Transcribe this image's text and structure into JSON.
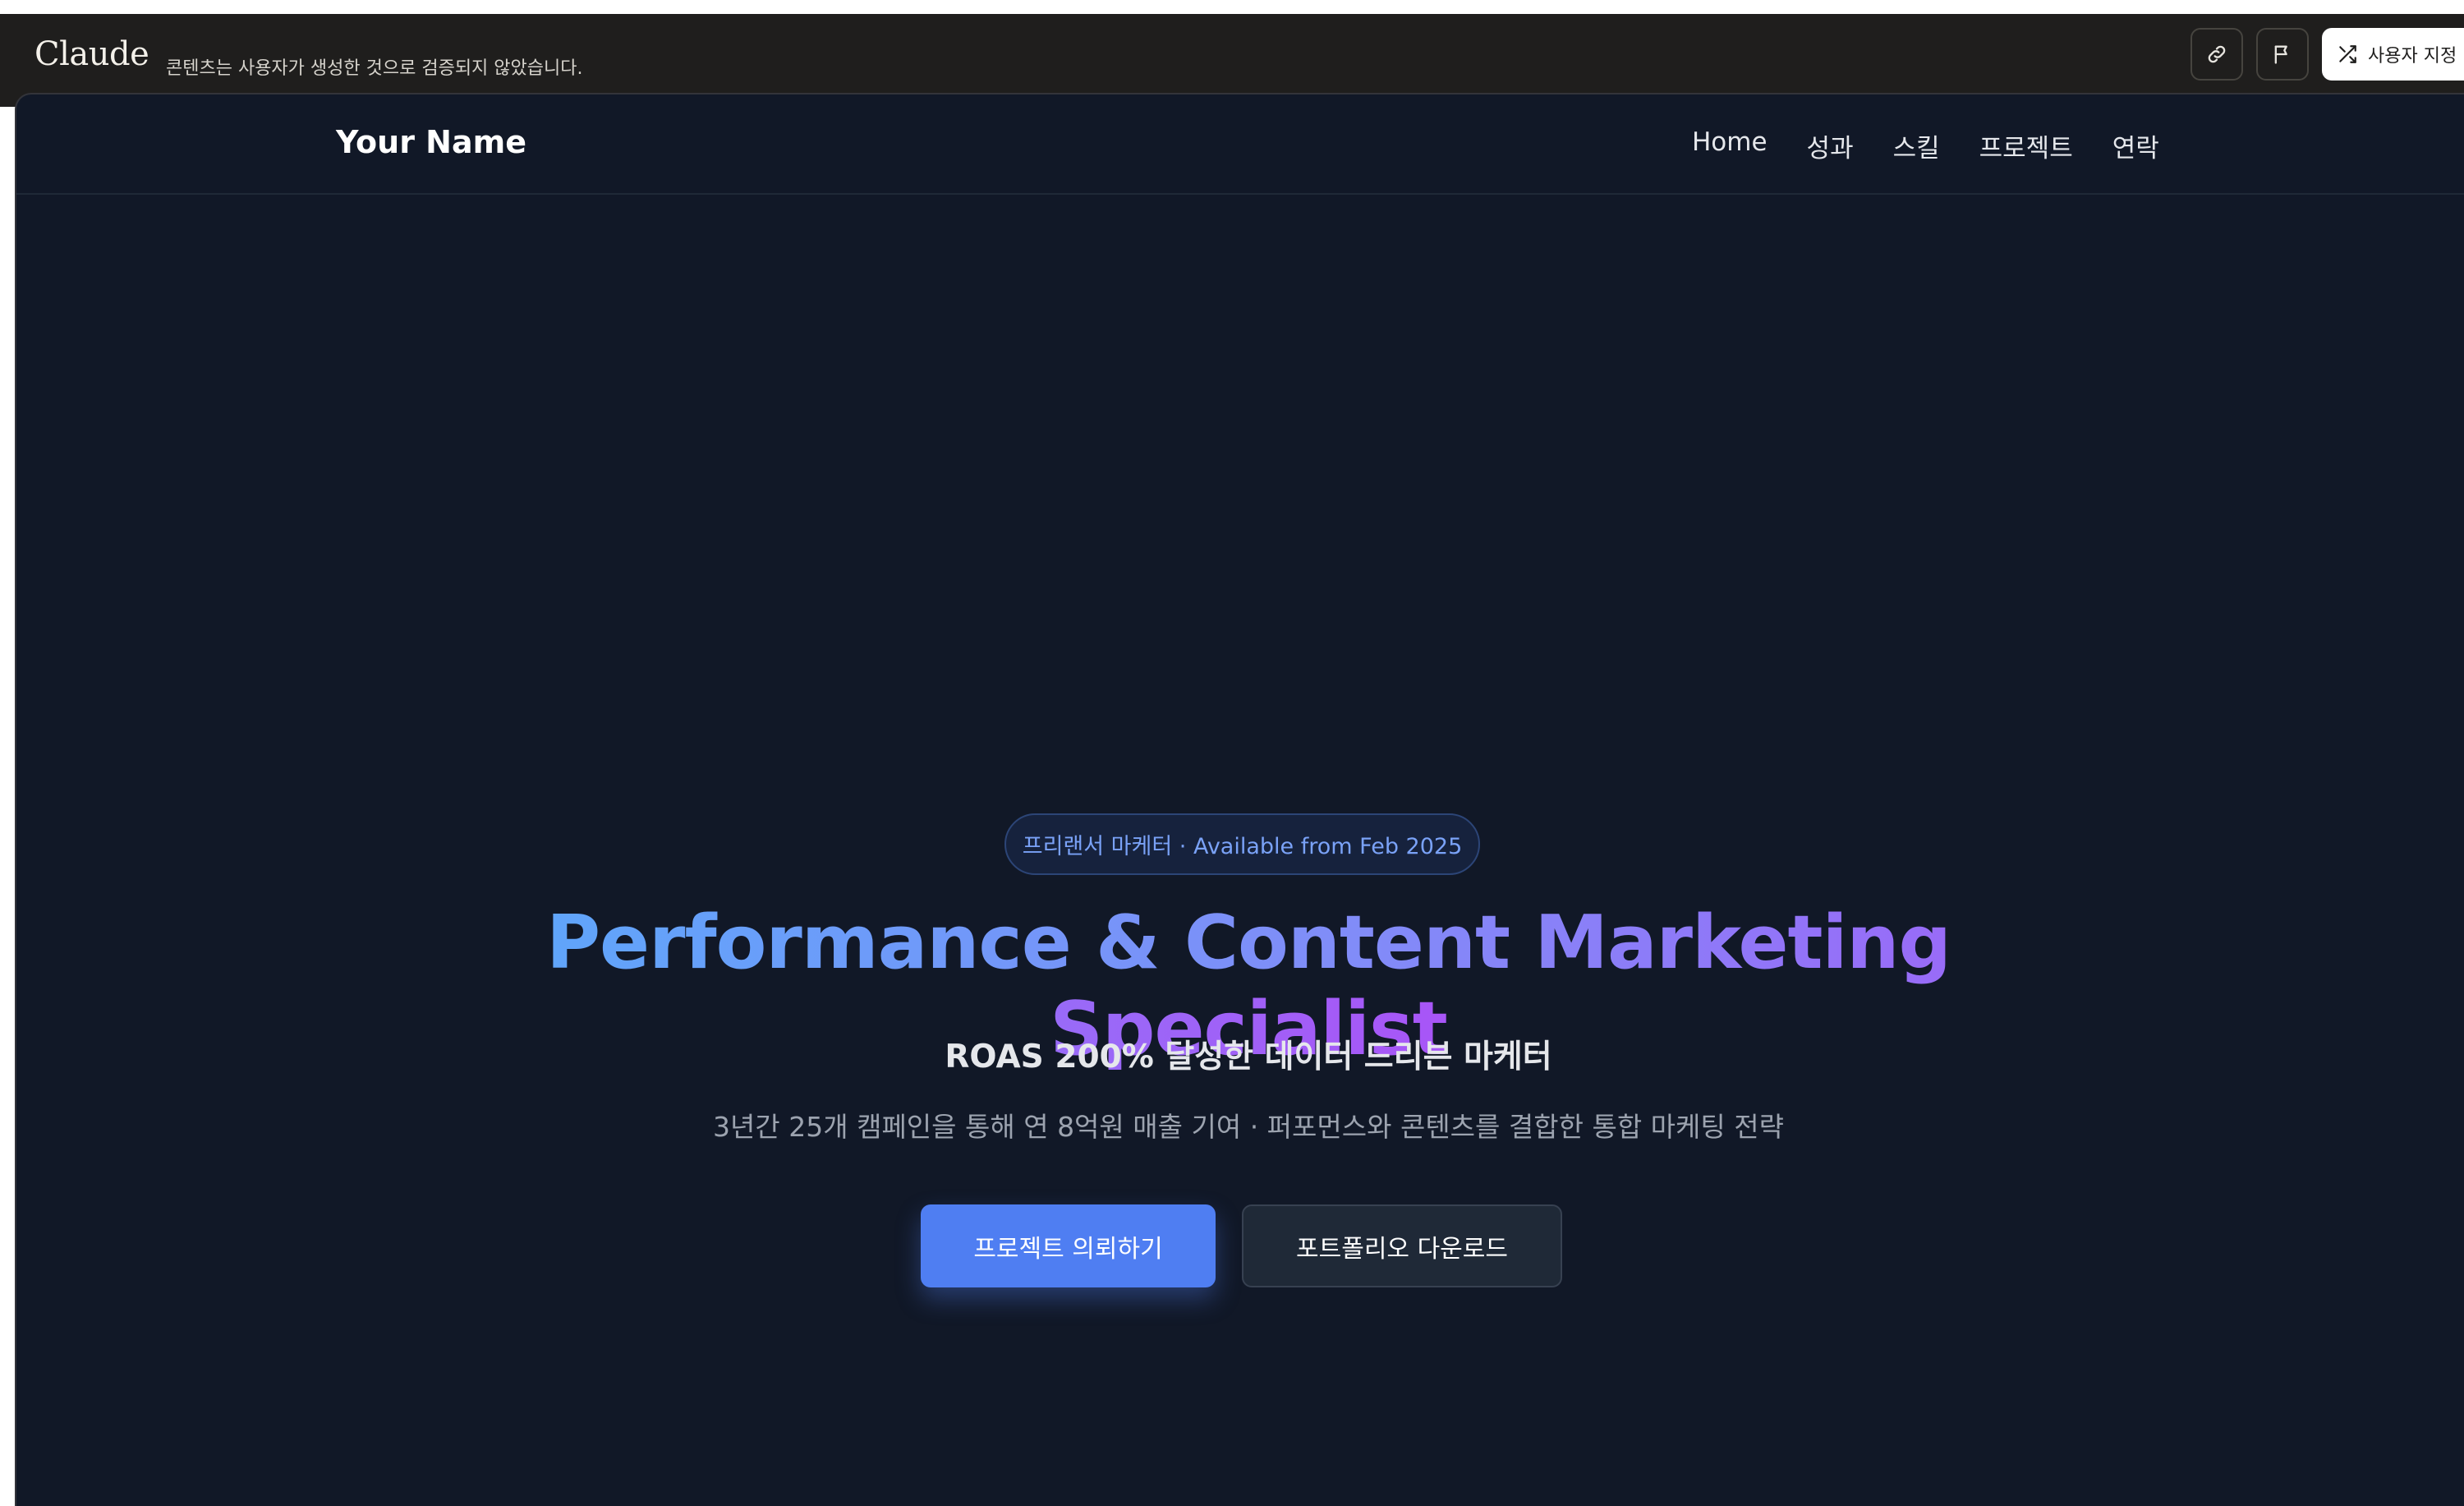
{
  "topbar": {
    "logo": "Claude",
    "notice": "콘텐츠는 사용자가 생성한 것으로 검증되지 않았습니다.",
    "link_icon": "link-icon",
    "flag_icon": "flag-icon",
    "customize_icon": "shuffle-icon",
    "customize_label": "사용자 지정"
  },
  "site": {
    "brand": "Your Name",
    "nav": [
      "Home",
      "성과",
      "스킬",
      "프로젝트",
      "연락"
    ]
  },
  "hero": {
    "badge": "프리랜서 마케터 · Available from Feb 2025",
    "headline": "Performance & Content Marketing Specialist",
    "subtitle": "ROAS 200% 달성한 데이터 드리븐 마케터",
    "description": "3년간 25개 캠페인을 통해 연 8억원 매출 기여 · 퍼포먼스와 콘텐츠를 결합한 통합 마케팅 전략",
    "primary_cta": "프로젝트 의뢰하기",
    "secondary_cta": "포트폴리오 다운로드"
  },
  "colors": {
    "page_bg": "#111827",
    "topbar_bg": "#1f1e1d",
    "accent": "#4f7ef2",
    "gradient_start": "#60a5fa",
    "gradient_end": "#a855f7"
  }
}
